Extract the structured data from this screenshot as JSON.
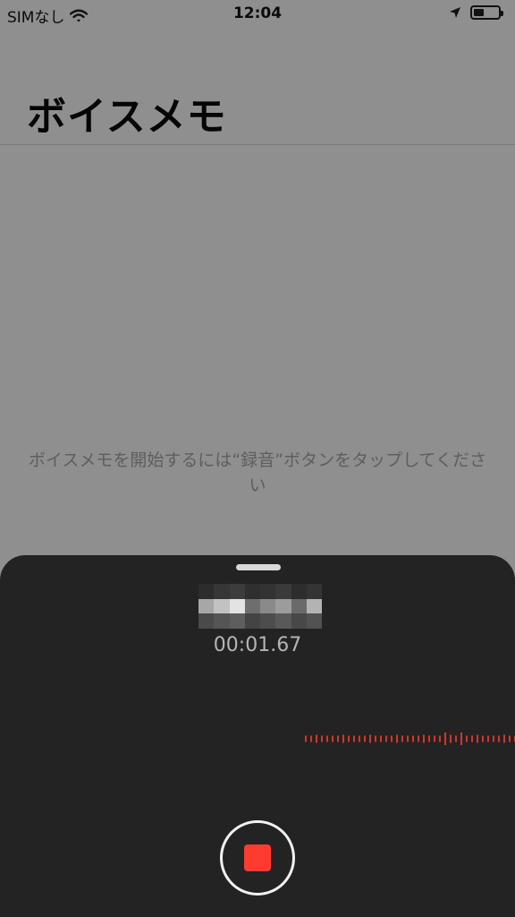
{
  "status_bar": {
    "carrier": "SIMなし",
    "time": "12:04",
    "icons": [
      "wifi-icon",
      "location-arrow-icon",
      "battery-icon"
    ]
  },
  "page": {
    "title": "ボイスメモ"
  },
  "empty_state": {
    "message": "ボイスメモを開始するには“録音”ボタンをタップしてください"
  },
  "recorder": {
    "elapsed_time": "00:01.67",
    "stop_button_icon": "stop-icon",
    "accent_color": "#ff3b30"
  }
}
